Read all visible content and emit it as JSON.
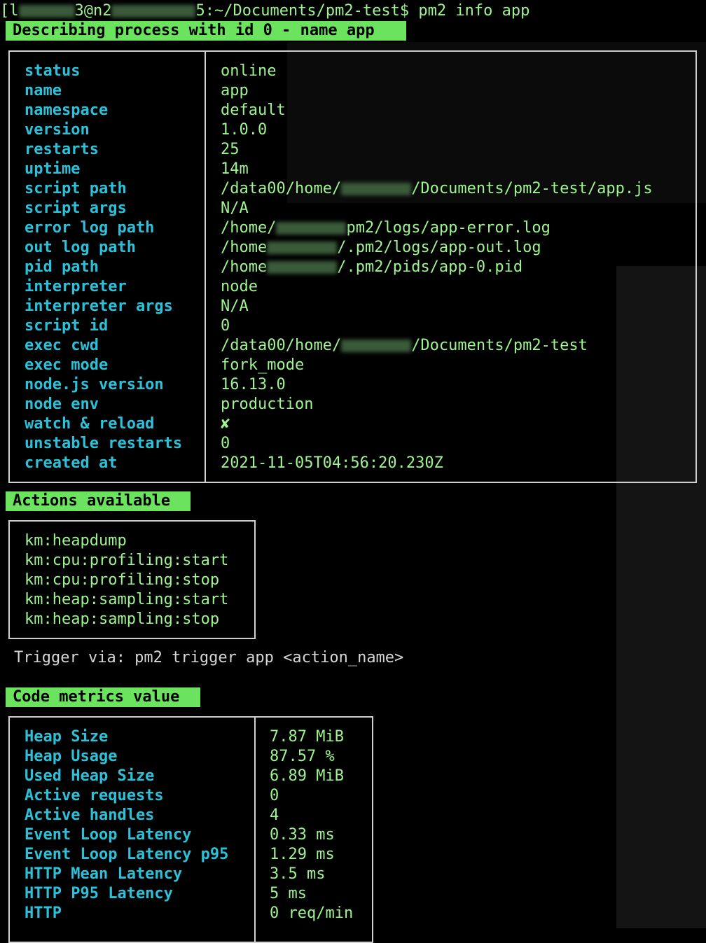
{
  "prompt": {
    "user_masked": "[l",
    "host_masked": "3@n2",
    "path": "5:~/Documents/pm2-test$",
    "command": "pm2 info app"
  },
  "describe_banner": "Describing process with id 0 - name app",
  "process_info": [
    {
      "key": "status",
      "value": "online"
    },
    {
      "key": "name",
      "value": "app"
    },
    {
      "key": "namespace",
      "value": "default"
    },
    {
      "key": "version",
      "value": "1.0.0"
    },
    {
      "key": "restarts",
      "value": "25"
    },
    {
      "key": "uptime",
      "value": "14m"
    },
    {
      "key": "script path",
      "value": "/data00/home/",
      "value_tail": "/Documents/pm2-test/app.js"
    },
    {
      "key": "script args",
      "value": "N/A"
    },
    {
      "key": "error log path",
      "value": "/home/",
      "value_tail": "pm2/logs/app-error.log"
    },
    {
      "key": "out log path",
      "value": "/home",
      "value_tail": "/.pm2/logs/app-out.log"
    },
    {
      "key": "pid path",
      "value": "/home",
      "value_tail": "/.pm2/pids/app-0.pid"
    },
    {
      "key": "interpreter",
      "value": "node"
    },
    {
      "key": "interpreter args",
      "value": "N/A"
    },
    {
      "key": "script id",
      "value": "0"
    },
    {
      "key": "exec cwd",
      "value": "/data00/home/",
      "value_tail": "/Documents/pm2-test"
    },
    {
      "key": "exec mode",
      "value": "fork_mode"
    },
    {
      "key": "node.js version",
      "value": "16.13.0"
    },
    {
      "key": "node env",
      "value": "production"
    },
    {
      "key": "watch & reload",
      "value": "✘"
    },
    {
      "key": "unstable restarts",
      "value": "0"
    },
    {
      "key": "created at",
      "value": "2021-11-05T04:56:20.230Z"
    }
  ],
  "actions_banner": "Actions available",
  "actions": [
    "km:heapdump",
    "km:cpu:profiling:start",
    "km:cpu:profiling:stop",
    "km:heap:sampling:start",
    "km:heap:sampling:stop"
  ],
  "trigger_hint": "Trigger via: pm2 trigger app <action_name>",
  "metrics_banner": "Code metrics value",
  "metrics": [
    {
      "key": "Heap Size",
      "value": "7.87 MiB"
    },
    {
      "key": "Heap Usage",
      "value": "87.57 %"
    },
    {
      "key": "Used Heap Size",
      "value": "6.89 MiB"
    },
    {
      "key": "Active requests",
      "value": "0"
    },
    {
      "key": "Active handles",
      "value": "4"
    },
    {
      "key": "Event Loop Latency",
      "value": "0.33 ms"
    },
    {
      "key": "Event Loop Latency p95",
      "value": "1.29 ms"
    },
    {
      "key": "HTTP Mean Latency",
      "value": "3.5 ms"
    },
    {
      "key": "HTTP P95 Latency",
      "value": "5 ms"
    },
    {
      "key": "HTTP",
      "value": "0 req/min"
    }
  ],
  "colors": {
    "background": "#000000",
    "value_green": "#9ef58f",
    "key_cyan": "#2cc1d9",
    "banner_green": "#6be35f",
    "border": "#cfcfcf"
  }
}
